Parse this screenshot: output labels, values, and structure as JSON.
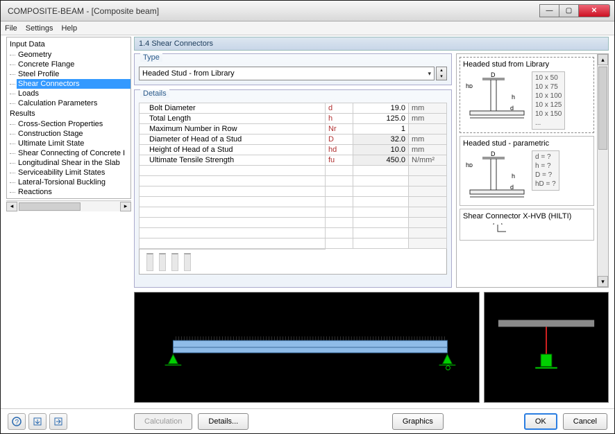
{
  "window": {
    "title": "COMPOSITE-BEAM - [Composite beam]"
  },
  "menu": [
    "File",
    "Settings",
    "Help"
  ],
  "tree": {
    "input": {
      "label": "Input Data",
      "items": [
        "Geometry",
        "Concrete Flange",
        "Steel Profile",
        "Shear Connectors",
        "Loads",
        "Calculation Parameters"
      ],
      "selected": "Shear Connectors"
    },
    "results": {
      "label": "Results",
      "items": [
        "Cross-Section Properties",
        "Construction Stage",
        "Ultimate Limit State",
        "Shear Connecting of Concrete I",
        "Longitudinal Shear in the Slab",
        "Serviceability Limit States",
        "Lateral-Torsional Buckling",
        "Reactions"
      ]
    }
  },
  "page": {
    "title": "1.4 Shear Connectors"
  },
  "type": {
    "legend": "Type",
    "selected": "Headed Stud - from Library"
  },
  "details": {
    "legend": "Details",
    "rows": [
      {
        "label": "Bolt Diameter",
        "sym": "d",
        "val": "19.0",
        "unit": "mm",
        "readonly": false
      },
      {
        "label": "Total Length",
        "sym": "h",
        "val": "125.0",
        "unit": "mm",
        "readonly": false
      },
      {
        "label": "Maximum Number in Row",
        "sym": "Nr",
        "val": "1",
        "unit": "",
        "readonly": false
      },
      {
        "label": "Diameter of Head of a Stud",
        "sym": "D",
        "val": "32.0",
        "unit": "mm",
        "readonly": true
      },
      {
        "label": "Height of Head of a Stud",
        "sym": "hd",
        "val": "10.0",
        "unit": "mm",
        "readonly": true
      },
      {
        "label": "Ultimate Tensile Strength",
        "sym": "fu",
        "val": "450.0",
        "unit": "N/mm²",
        "readonly": true
      }
    ],
    "empty_rows": 8
  },
  "library": [
    {
      "title": "Headed stud from Library",
      "sizes": [
        "10 x 50",
        "10 x 75",
        "10 x 100",
        "10 x 125",
        "10 x 150",
        "..."
      ]
    },
    {
      "title": "Headed stud - parametric",
      "params": [
        "d  = ?",
        "h  = ?",
        "D  = ?",
        "hD = ?"
      ]
    },
    {
      "title": "Shear Connector X-HVB (HILTI)"
    }
  ],
  "buttons": {
    "calculation": "Calculation",
    "details": "Details...",
    "graphics": "Graphics",
    "ok": "OK",
    "cancel": "Cancel"
  }
}
